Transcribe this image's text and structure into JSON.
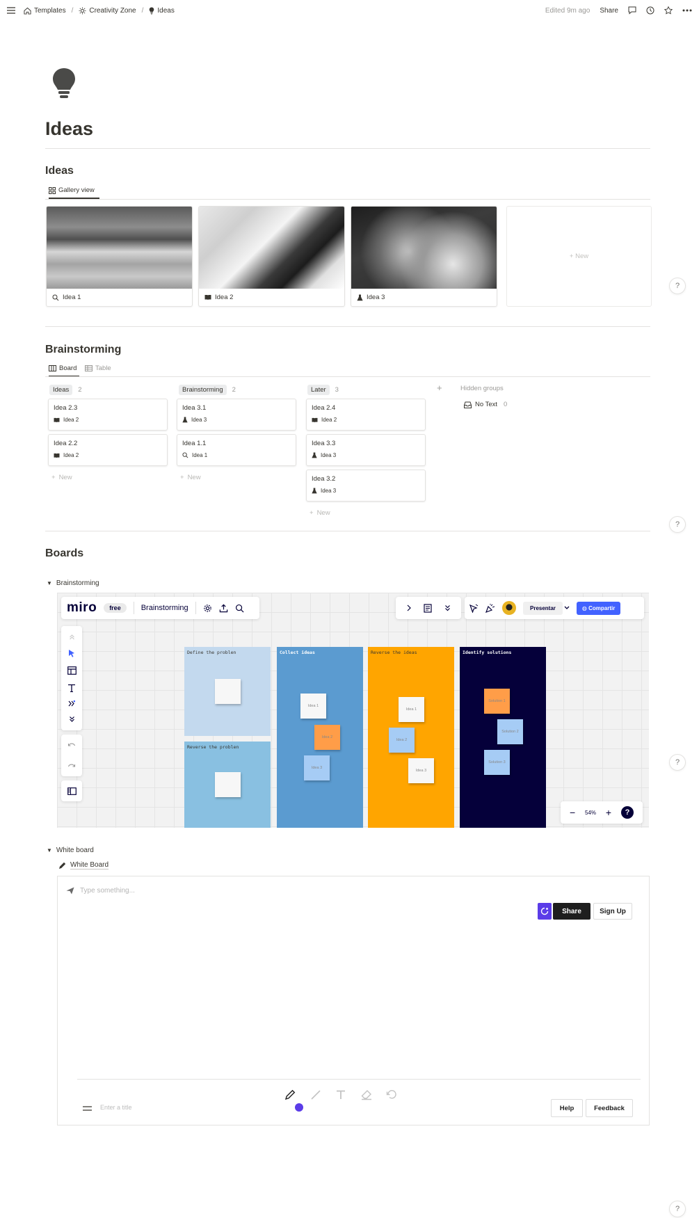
{
  "topbar": {
    "breadcrumbs": [
      "Templates",
      "Creativity Zone",
      "Ideas"
    ],
    "edited": "Edited 9m ago",
    "share": "Share"
  },
  "page": {
    "title": "Ideas"
  },
  "ideas_section": {
    "title": "Ideas",
    "view_tab": "Gallery view",
    "cards": [
      {
        "label": "Idea 1",
        "icon": "search-icon"
      },
      {
        "label": "Idea 2",
        "icon": "book-icon"
      },
      {
        "label": "Idea 3",
        "icon": "flask-icon"
      }
    ],
    "new_label": "New"
  },
  "brainstorming_section": {
    "title": "Brainstorming",
    "tabs": [
      "Board",
      "Table"
    ],
    "columns": [
      {
        "name": "Ideas",
        "count": "2",
        "cards": [
          {
            "title": "Idea 2.3",
            "sub": "Idea 2"
          },
          {
            "title": "Idea 2.2",
            "sub": "Idea 2"
          }
        ]
      },
      {
        "name": "Brainstorming",
        "count": "2",
        "cards": [
          {
            "title": "Idea 3.1",
            "sub": "Idea 3"
          },
          {
            "title": "Idea 1.1",
            "sub": "Idea 1"
          }
        ]
      },
      {
        "name": "Later",
        "count": "3",
        "cards": [
          {
            "title": "Idea 2.4",
            "sub": "Idea 2"
          },
          {
            "title": "Idea 3.3",
            "sub": "Idea 3"
          },
          {
            "title": "Idea 3.2",
            "sub": "Idea 3"
          }
        ]
      }
    ],
    "new_label": "New",
    "hidden_groups": "Hidden groups",
    "no_text": "No Text",
    "no_text_count": "0"
  },
  "boards_section": {
    "title": "Boards",
    "toggle1": "Brainstorming",
    "toggle2": "White board",
    "whiteboard_link": "White Board"
  },
  "miro": {
    "logo": "miro",
    "plan": "free",
    "board_name": "Brainstorming",
    "present": "Presentar",
    "share": "Compartir",
    "zoom": "54%",
    "frames": [
      {
        "label": "Define the problen",
        "color": "#c3d9ee"
      },
      {
        "label": "Reverse the problen",
        "color": "#89c0e1"
      },
      {
        "label": "Collect ideas",
        "color": "#5b9bd0"
      },
      {
        "label": "Reverse the ideas",
        "color": "#ffa500"
      },
      {
        "label": "Identify solutions",
        "color": "#05003a"
      }
    ],
    "stickies": [
      "Idea 1",
      "Idea 2",
      "Idea 3",
      "Idea 1",
      "Idea 2",
      "Idea 3",
      "Solution 1",
      "Solution 2",
      "Solution 3"
    ]
  },
  "whiteboard": {
    "placeholder": "Type something...",
    "share": "Share",
    "signup": "Sign Up",
    "title_placeholder": "Enter a title",
    "help": "Help",
    "feedback": "Feedback"
  },
  "help_button": "?"
}
